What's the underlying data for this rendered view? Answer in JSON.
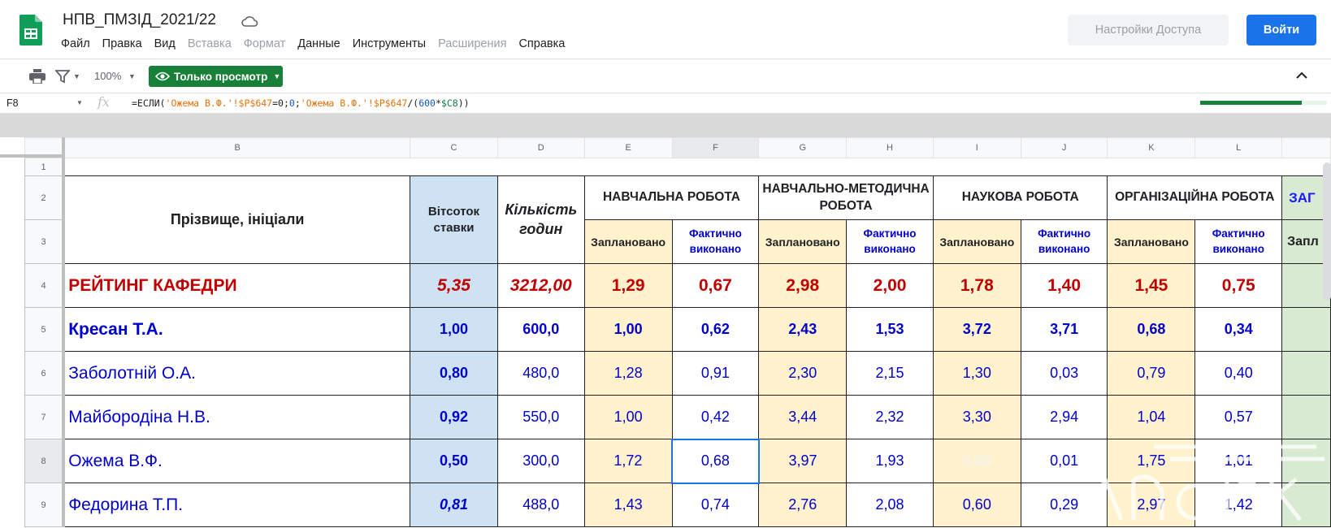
{
  "app": {
    "doc_title": "НПВ_ПМЗІД_2021/22",
    "access_button": "Настройки Доступа",
    "login_button": "Войти"
  },
  "menu": {
    "items": [
      {
        "label": "Файл",
        "enabled": true
      },
      {
        "label": "Правка",
        "enabled": true
      },
      {
        "label": "Вид",
        "enabled": true
      },
      {
        "label": "Вставка",
        "enabled": false
      },
      {
        "label": "Формат",
        "enabled": false
      },
      {
        "label": "Данные",
        "enabled": true
      },
      {
        "label": "Инструменты",
        "enabled": true
      },
      {
        "label": "Расширения",
        "enabled": false
      },
      {
        "label": "Справка",
        "enabled": true
      }
    ]
  },
  "toolbar": {
    "zoom": "100%",
    "view_mode": "Только просмотр",
    "icons": [
      "print-icon",
      "filter-icon",
      "eye-icon",
      "chevron-up-icon"
    ]
  },
  "formula_bar": {
    "cell_ref": "F8",
    "fx": "fx",
    "formula": {
      "p1": "=ЕСЛИ(",
      "p2": "'Ожема В.Ф.'!$P$647",
      "p3": "=0;",
      "p4": "0",
      "p5": ";",
      "p6": "'Ожема В.Ф.'!$P$647",
      "p7": "/(",
      "p8": "600",
      "p9": "*",
      "p10": "$C8",
      "p11": "))"
    },
    "progress": 0.8
  },
  "sheet": {
    "columns": [
      "B",
      "C",
      "D",
      "E",
      "F",
      "G",
      "H",
      "I",
      "J",
      "K",
      "L"
    ],
    "selected_column": "F",
    "row_numbers": [
      "1",
      "2",
      "3",
      "4",
      "5",
      "6",
      "7",
      "8",
      "9"
    ],
    "header": {
      "name": "Прізвище, ініціали",
      "percent": "Вітсоток ставки",
      "hours": "Кількість годин",
      "sections": [
        "НАВЧАЛЬНА РОБОТА",
        "НАВЧАЛЬНО-МЕТОДИЧНА РОБОТА",
        "НАУКОВА РОБОТА",
        "ОРГАНІЗАЦІЙНА РОБОТА"
      ],
      "extra_section": "ЗАГ",
      "planned": "Заплановано",
      "done": "Фактично виконано",
      "extra_planned": "Запл"
    },
    "rating": {
      "name": "РЕЙТИНГ КАФЕДРИ",
      "percent": "5,35",
      "hours": "3212,00",
      "values": [
        "1,29",
        "0,67",
        "2,98",
        "2,00",
        "1,78",
        "1,40",
        "1,45",
        "0,75"
      ]
    },
    "rows": [
      {
        "name": "Кресан Т.А.",
        "percent": "1,00",
        "hours": "600,0",
        "values": [
          "1,00",
          "0,62",
          "2,43",
          "1,53",
          "3,72",
          "3,71",
          "0,68",
          "0,34"
        ]
      },
      {
        "name": "Заболотній О.А.",
        "percent": "0,80",
        "hours": "480,0",
        "values": [
          "1,28",
          "0,91",
          "2,30",
          "2,15",
          "1,30",
          "0,03",
          "0,79",
          "0,40"
        ]
      },
      {
        "name": "Майбородіна Н.В.",
        "percent": "0,92",
        "hours": "550,0",
        "values": [
          "1,00",
          "0,42",
          "3,44",
          "2,32",
          "3,30",
          "2,94",
          "1,04",
          "0,57"
        ]
      },
      {
        "name": "Ожема В.Ф.",
        "percent": "0,50",
        "hours": "300,0",
        "values": [
          "1,72",
          "0,68",
          "3,97",
          "1,93",
          "0,00",
          "0,01",
          "1,75",
          "1,01"
        ]
      },
      {
        "name": "Федорина Т.П.",
        "percent": "0,81",
        "hours": "488,0",
        "values": [
          "1,43",
          "0,74",
          "2,76",
          "2,08",
          "0,60",
          "0,29",
          "2,97",
          "1,42"
        ]
      }
    ]
  },
  "watermark": "naurok"
}
